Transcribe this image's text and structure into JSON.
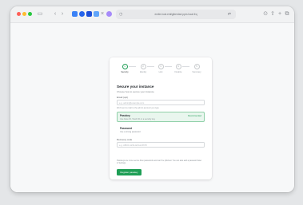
{
  "browser": {
    "address": "emile-host.emilgiberdari.ppm.local.frq",
    "toolbar_icons": [
      "sidebar-icon",
      "back-icon",
      "forward-icon",
      "tab-icon",
      "share-icon",
      "new-tab-icon",
      "tab-overview-icon"
    ]
  },
  "stepper": {
    "steps": [
      {
        "num": "1",
        "label": "Security"
      },
      {
        "num": "2",
        "label": "Identity"
      },
      {
        "num": "3",
        "label": "Link"
      },
      {
        "num": "4",
        "label": "Finalize"
      },
      {
        "num": "5",
        "label": "Summary"
      }
    ],
    "active_index": 0
  },
  "form": {
    "title": "Secure your instance",
    "subtitle": "Choose how to secure your instance",
    "email_label": "Email (opt)",
    "email_placeholder": "e.g. admin@example.com",
    "email_hint": "We'll send a mail to the admin account you type",
    "options": [
      {
        "title": "Passkey",
        "desc": "Use Face ID, Touch ID or a security key",
        "badge": "Recommended",
        "selected": true
      },
      {
        "title": "Password",
        "desc": "Use a strong password",
        "badge": "",
        "selected": false
      }
    ],
    "recovery_label": "Recovery code",
    "recovery_placeholder": "e.g. ABCD-1234-EFGH-5678",
    "description": "Passkeys are more secure than passwords and can't be phished. You can also add a password later in Settings.",
    "button": "Register passkey"
  },
  "colors": {
    "accent": "#1e9e55",
    "selected_bg": "#e9f6ee"
  }
}
